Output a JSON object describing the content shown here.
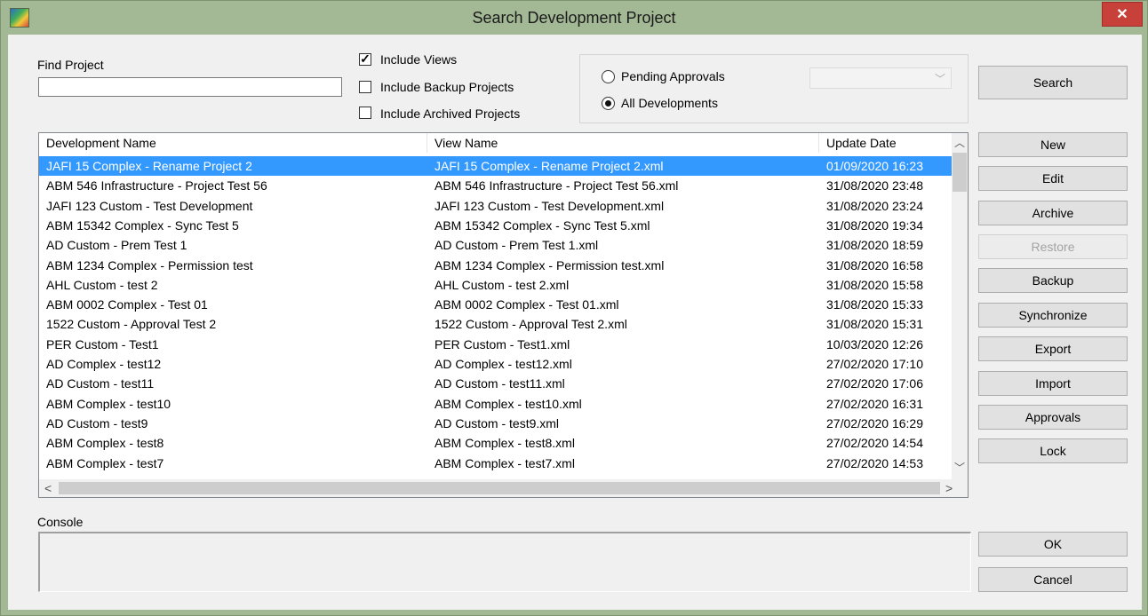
{
  "window": {
    "title": "Search Development Project",
    "close_glyph": "✕"
  },
  "find": {
    "label": "Find Project",
    "value": "",
    "placeholder": ""
  },
  "options": {
    "include_views": {
      "label": "Include Views",
      "checked": true
    },
    "include_backup": {
      "label": "Include Backup Projects",
      "checked": false
    },
    "include_archived": {
      "label": "Include Archived Projects",
      "checked": false
    }
  },
  "filter": {
    "pending": {
      "label": "Pending Approvals",
      "selected": false
    },
    "all": {
      "label": "All Developments",
      "selected": true
    },
    "combo_value": ""
  },
  "buttons": {
    "search": "Search",
    "new": "New",
    "edit": "Edit",
    "archive": "Archive",
    "restore": "Restore",
    "backup": "Backup",
    "synchronize": "Synchronize",
    "export": "Export",
    "import": "Import",
    "approvals": "Approvals",
    "lock": "Lock",
    "ok": "OK",
    "cancel": "Cancel"
  },
  "table": {
    "columns": [
      "Development Name",
      "View Name",
      "Update Date"
    ],
    "rows": [
      [
        "JAFI 15 Complex - Rename Project 2",
        "JAFI 15 Complex - Rename Project 2.xml",
        "01/09/2020 16:23"
      ],
      [
        "ABM 546 Infrastructure - Project Test 56",
        "ABM 546 Infrastructure - Project Test 56.xml",
        "31/08/2020 23:48"
      ],
      [
        "JAFI 123 Custom - Test Development",
        "JAFI 123 Custom - Test Development.xml",
        "31/08/2020 23:24"
      ],
      [
        "ABM 15342 Complex - Sync Test 5",
        "ABM 15342 Complex - Sync Test 5.xml",
        "31/08/2020 19:34"
      ],
      [
        "AD Custom - Prem Test 1",
        "AD Custom - Prem Test 1.xml",
        "31/08/2020 18:59"
      ],
      [
        "ABM 1234 Complex - Permission test",
        "ABM 1234 Complex - Permission test.xml",
        "31/08/2020 16:58"
      ],
      [
        "AHL Custom - test 2",
        "AHL Custom - test 2.xml",
        "31/08/2020 15:58"
      ],
      [
        "ABM 0002 Complex - Test 01",
        "ABM 0002 Complex - Test 01.xml",
        "31/08/2020 15:33"
      ],
      [
        "1522 Custom - Approval Test 2",
        "1522 Custom - Approval Test 2.xml",
        "31/08/2020 15:31"
      ],
      [
        "PER Custom - Test1",
        "PER Custom - Test1.xml",
        "10/03/2020 12:26"
      ],
      [
        "AD Complex - test12",
        "AD Complex - test12.xml",
        "27/02/2020 17:10"
      ],
      [
        "AD Custom - test11",
        "AD Custom - test11.xml",
        "27/02/2020 17:06"
      ],
      [
        "ABM Complex - test10",
        "ABM Complex - test10.xml",
        "27/02/2020 16:31"
      ],
      [
        "AD Custom - test9",
        "AD Custom - test9.xml",
        "27/02/2020 16:29"
      ],
      [
        "ABM Complex - test8",
        "ABM Complex - test8.xml",
        "27/02/2020 14:54"
      ],
      [
        "ABM Complex - test7",
        "ABM Complex - test7.xml",
        "27/02/2020 14:53"
      ]
    ],
    "selected_row": 0,
    "scroll_glyphs": {
      "up": "︿",
      "down": "﹀",
      "left": "<",
      "right": ">"
    }
  },
  "console": {
    "label": "Console",
    "text": ""
  },
  "combo_glyph": "﹀"
}
